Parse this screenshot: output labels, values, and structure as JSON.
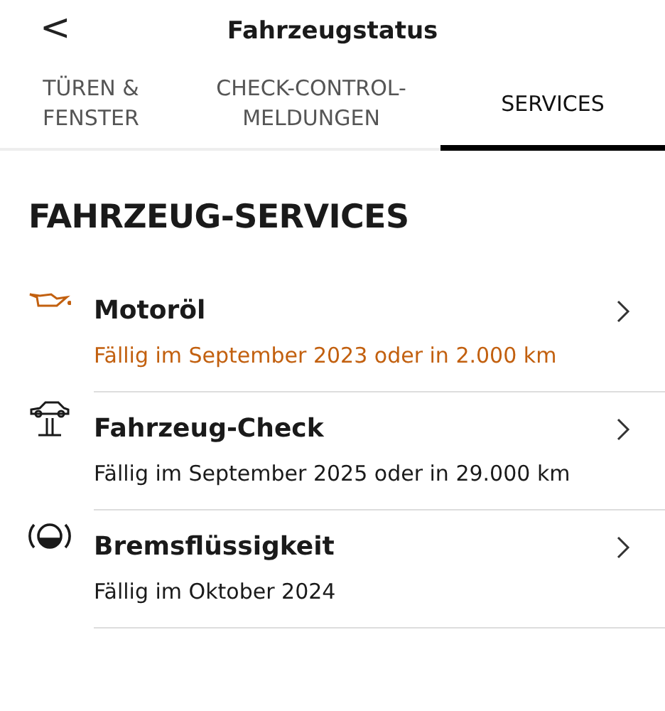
{
  "header": {
    "back": "<",
    "title": "Fahrzeugstatus"
  },
  "tabs": [
    {
      "label": "TÜREN &\nFENSTER",
      "selected": false
    },
    {
      "label": "CHECK-CONTROL-\nMELDUNGEN",
      "selected": false
    },
    {
      "label": "SERVICES",
      "selected": true
    }
  ],
  "section_title": "FAHRZEUG-SERVICES",
  "services": [
    {
      "kind": "oil",
      "title": "Motoröl",
      "due": "Fällig im September 2023 oder in 2.000 km",
      "color": "#c2600f"
    },
    {
      "kind": "lift",
      "title": "Fahrzeug-Check",
      "due": "Fällig im September 2025 oder in 29.000 km",
      "color": "#1a1a1a"
    },
    {
      "kind": "brake",
      "title": "Bremsflüssigkeit",
      "due": "Fällig im Oktober 2024",
      "color": "#1a1a1a"
    }
  ]
}
